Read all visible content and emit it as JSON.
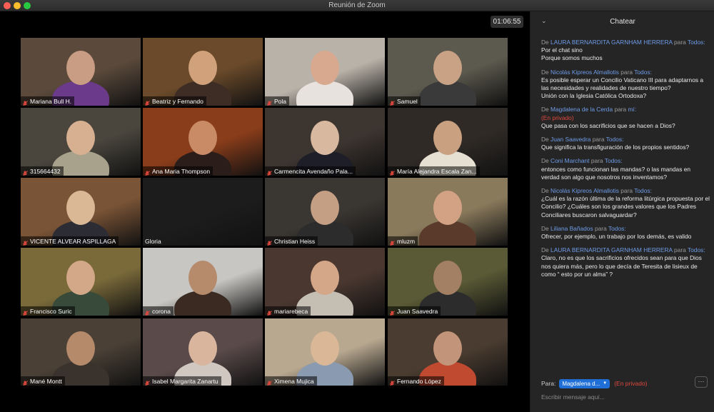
{
  "window": {
    "title": "Reunión de Zoom"
  },
  "meeting": {
    "timer": "01:06:55"
  },
  "participants": [
    {
      "name": "Mariana Bull H.",
      "bg": "#5b4a3c",
      "skin": "#c99d84",
      "cloth": "#6c3a8a"
    },
    {
      "name": "Beatriz y Fernando",
      "bg": "#6a4a2a",
      "skin": "#d0a17a",
      "cloth": "#3d2d25"
    },
    {
      "name": "Pola",
      "bg": "#b9b2a8",
      "skin": "#d9a98f",
      "cloth": "#e7e2dd"
    },
    {
      "name": "Samuel",
      "bg": "#5c5a4e",
      "skin": "#c9a184",
      "cloth": "#3a3a3a"
    },
    {
      "name": "315664432",
      "bg": "#4a463e",
      "skin": "#d6b090",
      "cloth": "#a8a28c"
    },
    {
      "name": "Ana Maria Thompson",
      "bg": "#8a3d1a",
      "skin": "#c98a66",
      "cloth": "#2a1d1a"
    },
    {
      "name": "Carmencita Avendaño Pala...",
      "bg": "#3d3530",
      "skin": "#d9b8a0",
      "cloth": "#1e1e28"
    },
    {
      "name": "María Alejandra Escala Zan...",
      "bg": "#2f2a26",
      "skin": "#c9a080",
      "cloth": "#e6e0d2"
    },
    {
      "name": "VICENTE ALVEAR ASPILLAGA",
      "bg": "#7a5436",
      "skin": "#dab896",
      "cloth": "#2c2c34"
    },
    {
      "name": "Gloria",
      "bg": "#1c1c1c",
      "skin": "#1c1c1c",
      "cloth": "#1c1c1c"
    },
    {
      "name": "Christian Heiss",
      "bg": "#3a3632",
      "skin": "#c49f84",
      "cloth": "#2c2c2c"
    },
    {
      "name": "mluzm",
      "bg": "#8a7a5c",
      "skin": "#d3a285",
      "cloth": "#5a3a2a"
    },
    {
      "name": "Francisco Suric",
      "bg": "#7a6a3a",
      "skin": "#d2a888",
      "cloth": "#384a3a"
    },
    {
      "name": "corona",
      "bg": "#c8c6c2",
      "skin": "#b58b6c",
      "cloth": "#3a2a22"
    },
    {
      "name": "mariarebeca",
      "bg": "#4a3830",
      "skin": "#d5a789",
      "cloth": "#c5bfb3"
    },
    {
      "name": "Juan Saavedra",
      "bg": "#5a5a36",
      "skin": "#a37f63",
      "cloth": "#2c2c2c"
    },
    {
      "name": "Mané Montt",
      "bg": "#4a4036",
      "skin": "#b58a6a",
      "cloth": "#3a322c"
    },
    {
      "name": "Isabel Margarita Zanartu",
      "bg": "#5a4a4a",
      "skin": "#d8b59c",
      "cloth": "#d0c8c0"
    },
    {
      "name": "Ximena Mujica",
      "bg": "#b8a890",
      "skin": "#d9b797",
      "cloth": "#8a9ab0"
    },
    {
      "name": "Fernando López",
      "bg": "#4a3c30",
      "skin": "#c2957a",
      "cloth": "#c04a30"
    }
  ],
  "chat": {
    "title": "Chatear",
    "messages": [
      {
        "from": "LAURA BERNARDITA GARNHAM HERRERA",
        "to_word": "para",
        "to": "Todos:",
        "private": "",
        "text": "Por el chat sino\nPorque somos muchos"
      },
      {
        "from": "Nicolás Kipreos Almallotis",
        "to_word": "para",
        "to": "Todos:",
        "private": "",
        "text": "Es posible esperar un Concilio Vaticano III para adaptarnos a las necesidades y realidades de nuestro tiempo?\nUnión con la Iglesia Católica Ortodoxa?"
      },
      {
        "from": "Magdalena de la Cerda",
        "to_word": "para",
        "to": "mí:",
        "private": "(En privado)",
        "text": "Que pasa con los sacrificios que se hacen a Dios?"
      },
      {
        "from": "Juan Saavedra",
        "to_word": "para",
        "to": "Todos:",
        "private": "",
        "text": "Que significa la transfiguración de los propios sentidos?"
      },
      {
        "from": "Coni Marchant",
        "to_word": "para",
        "to": "Todos:",
        "private": "",
        "text": "entonces como funcionan las mandas? o las mandas en verdad son algo que nosotros nos inventamos?"
      },
      {
        "from": "Nicolás Kipreos Almallotis",
        "to_word": "para",
        "to": "Todos:",
        "private": "",
        "text": "¿Cuál es la razón última de la reforma litúrgica propuesta por el Concilio? ¿Cuáles son los grandes valores que los Padres Conciliares buscaron salvaguardar?"
      },
      {
        "from": "Liliana Bañados",
        "to_word": "para",
        "to": "Todos:",
        "private": "",
        "text": "Ofrecer, por ejemplo, un trabajo por los demás, es valido"
      },
      {
        "from": "LAURA BERNARDITA GARNHAM HERRERA",
        "to_word": "para",
        "to": "Todos:",
        "private": "",
        "text": "Claro, no es que los sacrificios ofrecidos sean para que Dios nos quiera más, pero lo que decía de Teresita de lisieux de como “ esto por un alma” ?"
      }
    ],
    "to_label": "Para:",
    "recipient": "Magdalena d...",
    "recipient_private": "(En privado)",
    "more_label": "···",
    "input_placeholder": "Escribir mensaje aquí..."
  }
}
